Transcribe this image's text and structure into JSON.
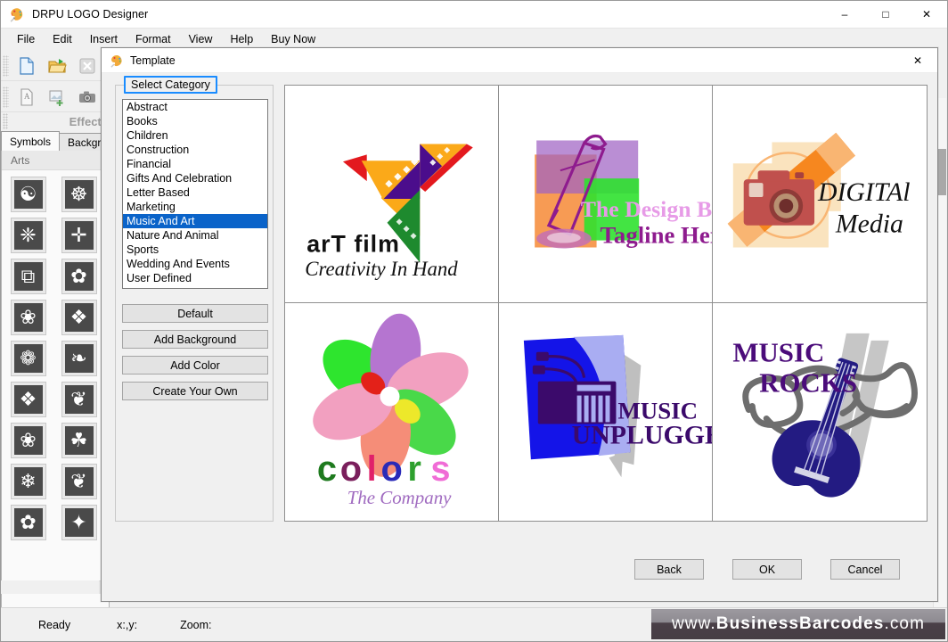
{
  "window": {
    "title": "DRPU LOGO Designer",
    "icon": "palette-icon",
    "controls": {
      "minimize": "–",
      "maximize": "□",
      "close": "✕"
    }
  },
  "menubar": {
    "items": [
      {
        "label": "File"
      },
      {
        "label": "Edit"
      },
      {
        "label": "Insert"
      },
      {
        "label": "Format"
      },
      {
        "label": "View"
      },
      {
        "label": "Help"
      },
      {
        "label": "Buy Now"
      }
    ]
  },
  "toolbar": {
    "row1": [
      "new-document-icon",
      "open-folder-icon",
      "close-document-icon"
    ],
    "row2": [
      "text-document-icon",
      "insert-image-icon",
      "camera-icon"
    ],
    "effects_label": "Effects"
  },
  "left_panel": {
    "tabs": [
      {
        "label": "Symbols",
        "active": true
      },
      {
        "label": "Background",
        "active": false
      }
    ],
    "section_header": "Arts",
    "symbols": [
      "☯",
      "☸",
      "❈",
      "✛",
      "⧉",
      "✿",
      "❀",
      "❖",
      "❁",
      "❧",
      "❖",
      "❦",
      "❀",
      "☘",
      "❄",
      "❦",
      "✿",
      "✦"
    ]
  },
  "statusbar": {
    "ready": "Ready",
    "coords_label": "x:,y:",
    "zoom_label": "Zoom:",
    "brand_prefix": "www.",
    "brand_main": "BusinessBarcodes",
    "brand_suffix": ".com"
  },
  "dialog": {
    "title": "Template",
    "icon": "palette-icon",
    "close_label": "✕",
    "category_group_legend": "Select Category",
    "categories": [
      {
        "label": "Abstract",
        "selected": false
      },
      {
        "label": "Books",
        "selected": false
      },
      {
        "label": "Children",
        "selected": false
      },
      {
        "label": "Construction",
        "selected": false
      },
      {
        "label": "Financial",
        "selected": false
      },
      {
        "label": "Gifts And Celebration",
        "selected": false
      },
      {
        "label": "Letter Based",
        "selected": false
      },
      {
        "label": "Marketing",
        "selected": false
      },
      {
        "label": "Music And Art",
        "selected": true
      },
      {
        "label": "Nature And Animal",
        "selected": false
      },
      {
        "label": "Sports",
        "selected": false
      },
      {
        "label": "Wedding And Events",
        "selected": false
      },
      {
        "label": "User Defined",
        "selected": false
      }
    ],
    "category_buttons": [
      {
        "label": "Default"
      },
      {
        "label": "Add Background"
      },
      {
        "label": "Add Color"
      },
      {
        "label": "Create Your Own"
      }
    ],
    "templates": [
      {
        "id": "art-film",
        "title": "arT film",
        "tagline": "Creativity In Hand",
        "art": "origami-bird",
        "colors": {
          "orange": "#FBA919",
          "purple": "#4B0D8C",
          "green": "#1E8A2E",
          "red": "#E3191E",
          "yellow": "#FFC20E"
        }
      },
      {
        "id": "design-bag",
        "title": "The Design Bag",
        "tagline": "Tagline Here",
        "art": "pencil",
        "colors": {
          "orange": "#F79B54",
          "purple": "#A063C4",
          "green": "#2FE12F",
          "magenta": "#8E1B8E",
          "pink": "#E79BE7"
        }
      },
      {
        "id": "digital-media",
        "title": "DIGITAl",
        "tagline": "Media",
        "art": "camera",
        "colors": {
          "orange": "#F6871F",
          "lightorange": "#F9B572",
          "cream": "#FAE3BE",
          "camera": "#C0504D"
        }
      },
      {
        "id": "colors-company",
        "title": "colors",
        "tagline": "The Company",
        "art": "flower",
        "colors": {
          "green": "#2EE52E",
          "purple": "#B575D0",
          "pink": "#F2A0C0",
          "salmon": "#F58D78",
          "yellow": "#EDE82A",
          "red": "#E32119"
        }
      },
      {
        "id": "music-unplugged",
        "title": "MUSIC",
        "tagline": "UNPLUGGED",
        "art": "keyboard",
        "colors": {
          "blue": "#1414E8",
          "lightblue": "#A9ADF2",
          "gray": "#BFBFBF",
          "purple": "#3B0A6B"
        }
      },
      {
        "id": "music-rocks",
        "title": "MUSIC",
        "tagline": "ROCKS",
        "art": "guitar",
        "colors": {
          "navy": "#231B82",
          "purple": "#4B0C7A",
          "gray": "#6E6E6E",
          "lightgray": "#C6C6C6"
        }
      }
    ],
    "footer_buttons": [
      {
        "label": "Back"
      },
      {
        "label": "OK"
      },
      {
        "label": "Cancel"
      }
    ]
  }
}
